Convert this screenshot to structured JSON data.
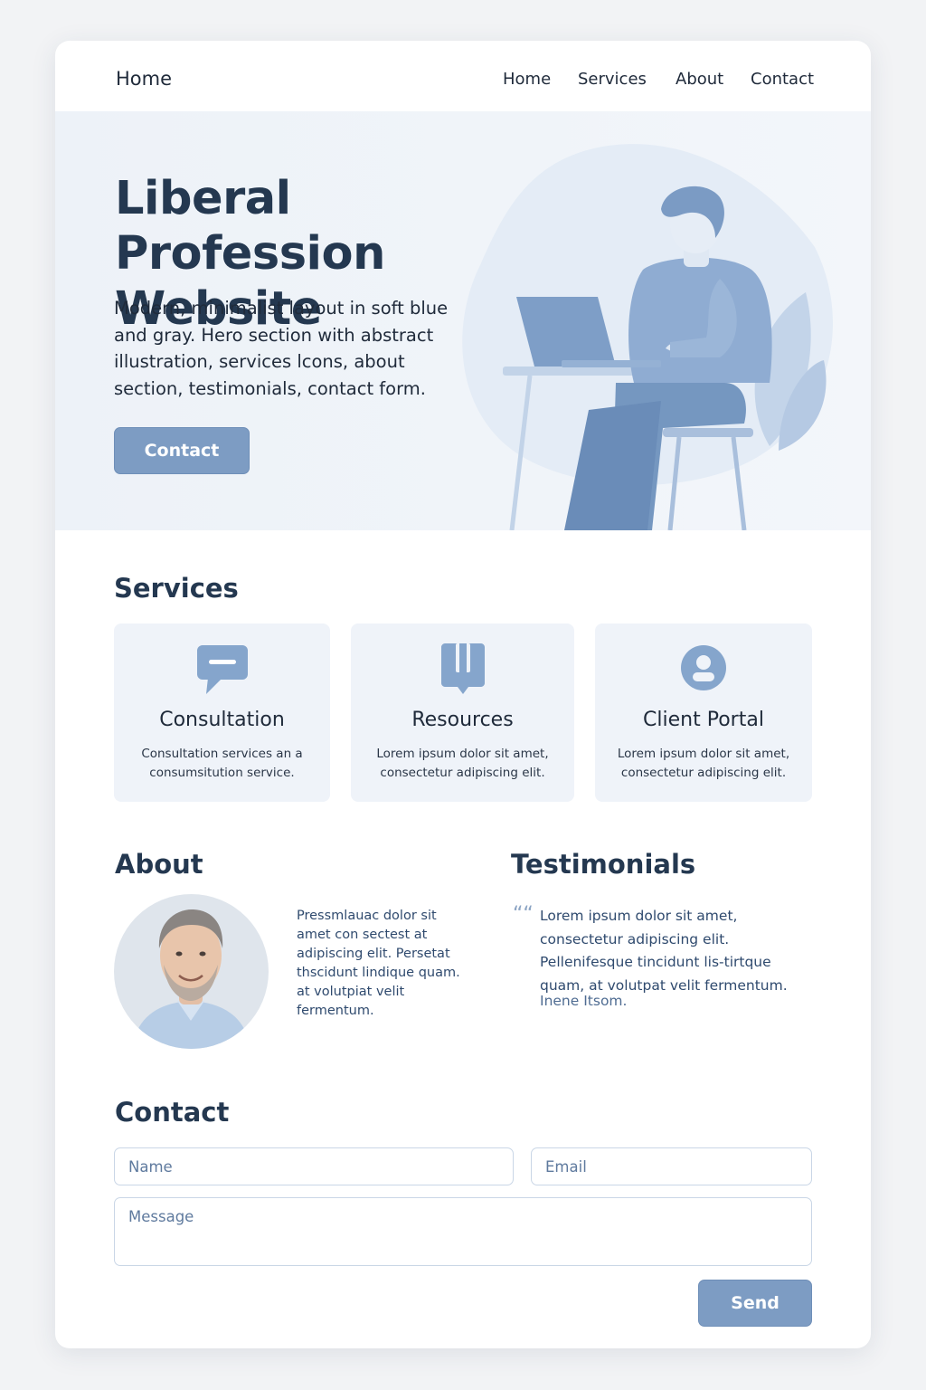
{
  "nav": {
    "brand": "Home",
    "links": [
      "Home",
      "Services",
      "About",
      "Contact"
    ]
  },
  "hero": {
    "title": "Liberal Profession Website",
    "description": "Modern, minimalist layout in soft blue and gray. Hero section with abstract illustration, services lcons, about section, testimonials, contact form.",
    "cta_label": "Contact"
  },
  "services": {
    "heading": "Services",
    "items": [
      {
        "title": "Consultation",
        "text": "Consultation services an a consumsitution service.",
        "icon": "chat-bubble-icon"
      },
      {
        "title": "Resources",
        "text": "Lorem ipsum dolor sit amet, consectetur adipiscing elit.",
        "icon": "bookmark-icon"
      },
      {
        "title": "Client Portal",
        "text": "Lorem ipsum dolor sit amet, consectetur adipiscing elit.",
        "icon": "user-circle-icon"
      }
    ]
  },
  "about": {
    "heading": "About",
    "text": "Pressmlauac dolor sit amet con sectest at adipiscing elit. Persetat thscidunt lindique quam. at volutpiat velit fermentum."
  },
  "testimonials": {
    "heading": "Testimonials",
    "quote_mark": "““",
    "text": "Lorem ipsum dolor sit amet, consectetur adipiscing elit. Pellenifesque tincidunt lis-tirtque quam, at volutpat velit fermentum.",
    "author": "Inene Itsom."
  },
  "contact": {
    "heading": "Contact",
    "name_placeholder": "Name",
    "email_placeholder": "Email",
    "message_placeholder": "Message",
    "send_label": "Send"
  },
  "colors": {
    "accent": "#7d9cc3",
    "heading": "#243850",
    "hero_bg": "#edf2f8",
    "card_bg": "#eff3f9"
  }
}
